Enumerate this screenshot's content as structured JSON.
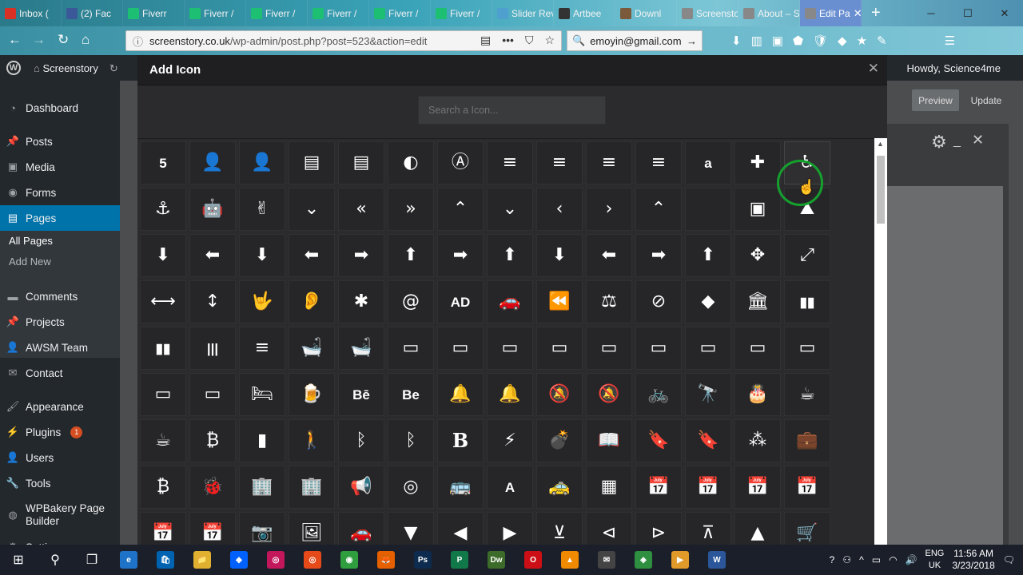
{
  "browser": {
    "tabs": [
      {
        "label": "Inbox (",
        "icon": "gmail-icon",
        "color": "#d93025"
      },
      {
        "label": "(2) Fac",
        "icon": "facebook-icon",
        "color": "#3b5998"
      },
      {
        "label": "Fiverr",
        "icon": "fiverr-icon",
        "color": "#1dbf73"
      },
      {
        "label": "Fiverr /",
        "icon": "fiverr-icon",
        "color": "#1dbf73"
      },
      {
        "label": "Fiverr /",
        "icon": "fiverr-icon",
        "color": "#1dbf73"
      },
      {
        "label": "Fiverr /",
        "icon": "fiverr-icon",
        "color": "#1dbf73"
      },
      {
        "label": "Fiverr /",
        "icon": "fiverr-icon",
        "color": "#1dbf73"
      },
      {
        "label": "Fiverr /",
        "icon": "fiverr-icon",
        "color": "#1dbf73"
      },
      {
        "label": "Slider Rev",
        "icon": "slider-icon",
        "color": "#4f9fcf"
      },
      {
        "label": "Artbee",
        "icon": "artbees-icon",
        "color": "#333333"
      },
      {
        "label": "Downl",
        "icon": "download-icon",
        "color": "#7a5a3a"
      },
      {
        "label": "Screenstory",
        "icon": "page-icon",
        "color": "#888888"
      },
      {
        "label": "About – Sc",
        "icon": "page-icon",
        "color": "#888888"
      },
      {
        "label": "Edit Pa",
        "icon": "page-icon",
        "color": "#888888",
        "active": true
      }
    ],
    "url_prefix": "screenstory.co.uk",
    "url_rest": "/wp-admin/post.php?post=523&action=edit",
    "search_text": "emoyin@gmail.com",
    "toolbar_badge": "0",
    "toolbar_badge2": "1"
  },
  "adminbar": {
    "site_name": "Screenstory",
    "howdy": "Howdy, Science4me"
  },
  "sidebar": {
    "items": [
      {
        "label": "Dashboard",
        "icon": "dashboard-icon"
      },
      {
        "label": "Posts",
        "icon": "pin-icon"
      },
      {
        "label": "Media",
        "icon": "media-icon"
      },
      {
        "label": "Forms",
        "icon": "forms-icon"
      },
      {
        "label": "Pages",
        "icon": "pages-icon",
        "current": true
      },
      {
        "label": "Comments",
        "icon": "comment-icon"
      },
      {
        "label": "Projects",
        "icon": "pin-icon"
      },
      {
        "label": "AWSM Team",
        "icon": "team-icon"
      },
      {
        "label": "Contact",
        "icon": "mail-icon"
      },
      {
        "label": "Appearance",
        "icon": "brush-icon"
      },
      {
        "label": "Plugins",
        "icon": "plugin-icon",
        "badge": "1"
      },
      {
        "label": "Users",
        "icon": "users-icon"
      },
      {
        "label": "Tools",
        "icon": "wrench-icon"
      },
      {
        "label": "WPBakery Page Builder",
        "icon": "wpbakery-icon"
      },
      {
        "label": "Settings",
        "icon": "settings-icon"
      }
    ],
    "sub_items": [
      "All Pages",
      "Add New"
    ]
  },
  "editor": {
    "preview_label": "Preview",
    "update_label": "Update"
  },
  "modal": {
    "title": "Add Icon",
    "search_placeholder": "Search a Icon..."
  },
  "icons": [
    [
      "5",
      "👤",
      "👤",
      "▤",
      "▤",
      "◐",
      "Ⓐ",
      "≡",
      "≡",
      "≡",
      "≡",
      "a",
      "✚",
      "♿"
    ],
    [
      "⚓",
      "🤖",
      "✌",
      "⌄",
      "«",
      "»",
      "⌃",
      "⌄",
      "‹",
      "›",
      "⌃",
      "",
      "▣",
      "⛰"
    ],
    [
      "⬇",
      "⬅",
      "⬇",
      "⬅",
      "➡",
      "⬆",
      "➡",
      "⬆",
      "⬇",
      "⬅",
      "➡",
      "⬆",
      "✥",
      "⤢"
    ],
    [
      "⟷",
      "↕",
      "🤟",
      "👂",
      "✱",
      "@",
      "AD",
      "🚗",
      "⏪",
      "⚖",
      "⊘",
      "◆",
      "🏛",
      "▮▮"
    ],
    [
      "▮▮",
      "|||",
      "≡",
      "🛁",
      "🛁",
      "▭",
      "▭",
      "▭",
      "▭",
      "▭",
      "▭",
      "▭",
      "▭",
      "▭"
    ],
    [
      "▭",
      "▭",
      "🛏",
      "🍺",
      "Bē",
      "Be",
      "🔔",
      "🔔",
      "🔕",
      "🔕",
      "🚲",
      "🔭",
      "🎂",
      "☕"
    ],
    [
      "☕",
      "₿",
      "▮",
      "🚶",
      "ᛒ",
      "ᛒ",
      "B",
      "⚡",
      "💣",
      "📖",
      "🔖",
      "🔖",
      "⁂",
      "💼"
    ],
    [
      "₿",
      "🐞",
      "🏢",
      "🏢",
      "📢",
      "◎",
      "🚌",
      "A",
      "🚕",
      "▦",
      "📅",
      "📅",
      "📅",
      "📅"
    ],
    [
      "📅",
      "📅",
      "📷",
      "🖼",
      "🚗",
      "▼",
      "◀",
      "▶",
      "⊻",
      "⊲",
      "⊳",
      "⊼",
      "▲",
      "🛒"
    ]
  ],
  "taskbar": {
    "time": "11:56 AM",
    "date": "3/23/2018",
    "lang1": "ENG",
    "lang2": "UK"
  }
}
